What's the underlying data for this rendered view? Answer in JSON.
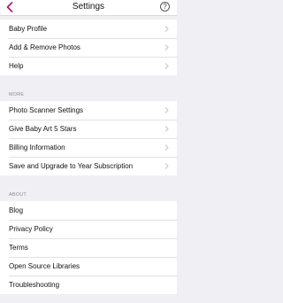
{
  "nav": {
    "title": "Settings",
    "back_icon": "chevron-left-icon",
    "help_label": "?",
    "accent_color": "#a6156e"
  },
  "top_group": [
    {
      "label": "Baby Profile"
    },
    {
      "label": "Add & Remove Photos"
    },
    {
      "label": "Help"
    }
  ],
  "more_section": {
    "header": "MORE",
    "items": [
      {
        "label": "Photo Scanner Settings"
      },
      {
        "label": "Give Baby Art 5 Stars"
      },
      {
        "label": "Billing Information"
      },
      {
        "label": "Save and Upgrade to Year Subscription"
      }
    ]
  },
  "about_section": {
    "header": "ABOUT",
    "items": [
      {
        "label": "Blog"
      },
      {
        "label": "Privacy Policy"
      },
      {
        "label": "Terms"
      },
      {
        "label": "Open Source Libraries"
      },
      {
        "label": "Troubleshooting"
      }
    ]
  }
}
